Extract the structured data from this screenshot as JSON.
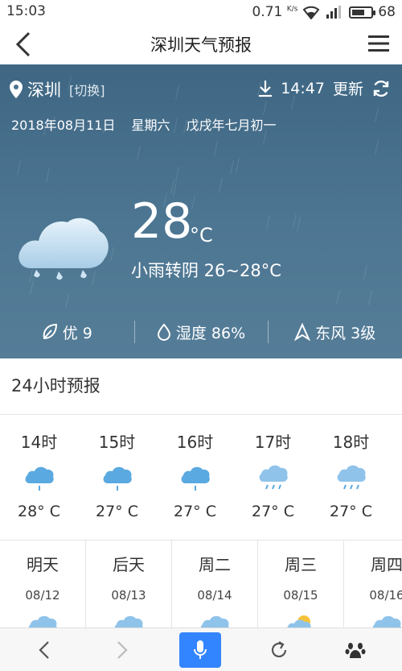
{
  "status_bar": {
    "time": "15:03",
    "speed": "0.71",
    "speed_unit": "K/s",
    "battery": "68",
    "battery_level_percent": 68
  },
  "nav": {
    "title": "深圳天气预报"
  },
  "current": {
    "city": "深圳",
    "switch_label": "[切换]",
    "update_time": "14:47",
    "update_label": "更新",
    "date": "2018年08月11日",
    "weekday": "星期六",
    "lunar": "戊戌年七月初一",
    "temperature": "28",
    "unit": "°C",
    "condition": "小雨转阴 26~28°C",
    "aqi": "优 9",
    "humidity": "湿度 86%",
    "wind": "东风 3级"
  },
  "hourly": {
    "title": "24小时预报",
    "items": [
      {
        "hour": "14时",
        "temp": "28° C",
        "icon": "cloud-rain-icon"
      },
      {
        "hour": "15时",
        "temp": "27° C",
        "icon": "cloud-rain-icon"
      },
      {
        "hour": "16时",
        "temp": "27° C",
        "icon": "cloud-rain-icon"
      },
      {
        "hour": "17时",
        "temp": "27° C",
        "icon": "cloud-rain-icon"
      },
      {
        "hour": "18时",
        "temp": "27° C",
        "icon": "cloud-rain-icon"
      }
    ]
  },
  "daily": [
    {
      "day": "明天",
      "date": "08/12",
      "icon": "cloud-icon"
    },
    {
      "day": "后天",
      "date": "08/13",
      "icon": "cloud-icon"
    },
    {
      "day": "周二",
      "date": "08/14",
      "icon": "cloud-icon"
    },
    {
      "day": "周三",
      "date": "08/15",
      "icon": "sun-cloud-icon"
    },
    {
      "day": "周四",
      "date": "08/16",
      "icon": "cloud-icon"
    }
  ],
  "colors": {
    "panel": "#4a7290",
    "accent": "#3385ff",
    "icon_blue": "#5aa9e0"
  }
}
